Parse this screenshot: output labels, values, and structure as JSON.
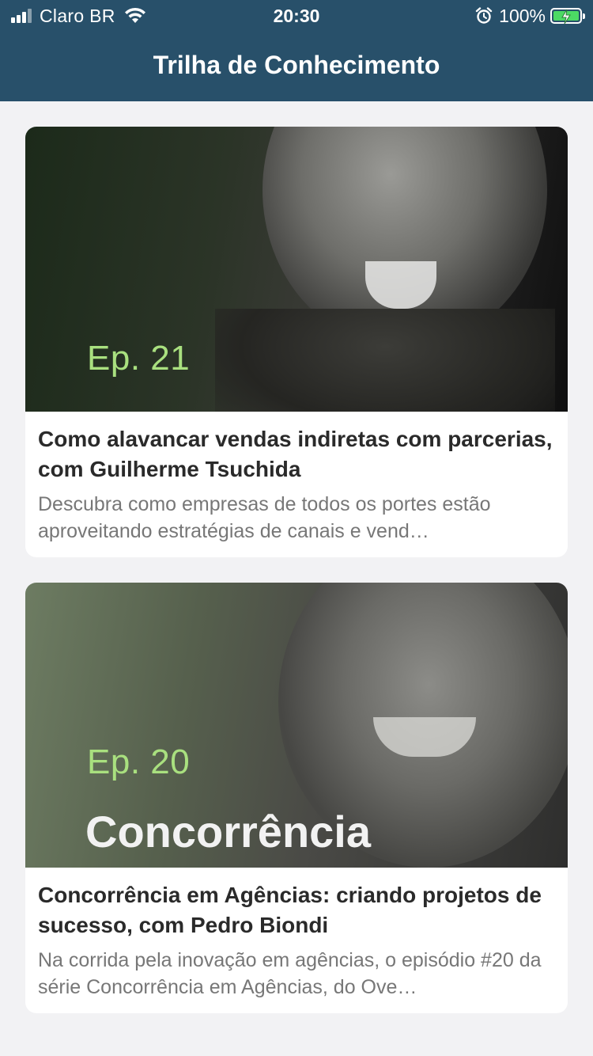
{
  "status_bar": {
    "carrier": "Claro BR",
    "time": "20:30",
    "battery_percent": "100%",
    "signal_bars_active": 3,
    "signal_bars_total": 4,
    "icons": [
      "signal-icon",
      "wifi-icon",
      "alarm-icon",
      "battery-charging-icon"
    ]
  },
  "header": {
    "title": "Trilha de Conhecimento",
    "background_color": "#28506a"
  },
  "episodes": [
    {
      "thumbnail_label": "Ep. 21",
      "title": "Como alavancar vendas indiretas com parcerias, com Guilherme Tsuchida",
      "description": "Descubra como empresas de todos os portes estão aproveitando estratégias de canais e vend…"
    },
    {
      "thumbnail_label": "Ep. 20",
      "thumbnail_heading": "Concorrência",
      "title": "Concorrência em Agências: criando projetos de sucesso, com Pedro Biondi",
      "description": "Na corrida pela inovação em agências, o episódio #20 da série Concorrência em Agências, do Ove…"
    }
  ],
  "colors": {
    "episode_label": "#a9e07f",
    "battery_fill": "#4cd964"
  }
}
